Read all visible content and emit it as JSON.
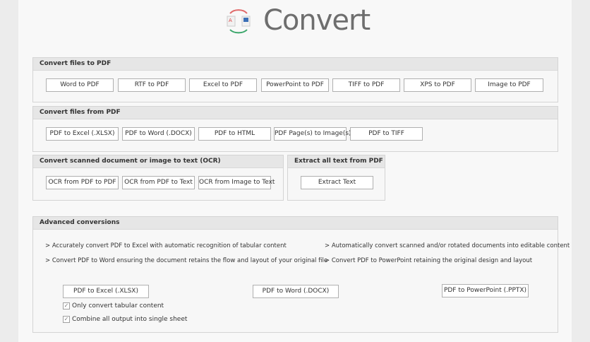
{
  "header": {
    "title": "Convert",
    "logo_icon": "pdf-word-convert-icon"
  },
  "to_pdf": {
    "title": "Convert files to PDF",
    "buttons": [
      "Word to PDF",
      "RTF to PDF",
      "Excel to PDF",
      "PowerPoint to PDF",
      "TIFF to PDF",
      "XPS to PDF",
      "Image to PDF"
    ]
  },
  "from_pdf": {
    "title": "Convert files from PDF",
    "buttons": [
      "PDF to Excel (.XLSX)",
      "PDF to Word (.DOCX)",
      "PDF to HTML",
      "PDF Page(s) to Image(s)",
      "PDF to TIFF"
    ]
  },
  "ocr": {
    "title": "Convert scanned document or image to text (OCR)",
    "buttons": [
      "OCR from PDF to PDF",
      "OCR from PDF to Text",
      "OCR from Image to Text"
    ]
  },
  "extract": {
    "title": "Extract all text from PDF",
    "button": "Extract Text"
  },
  "advanced": {
    "title": "Advanced conversions",
    "lines": [
      "> Accurately convert PDF to Excel with automatic recognition of tabular content",
      "> Automatically convert scanned and/or rotated documents into editable content",
      "> Convert PDF to Word ensuring the document retains the flow and layout of your original file",
      "> Convert PDF to PowerPoint retaining the original design and layout"
    ],
    "buttons": [
      "PDF to Excel (.XLSX)",
      "PDF to Word (.DOCX)",
      "PDF to PowerPoint (.PPTX)"
    ],
    "checkboxes": [
      {
        "label": "Only convert tabular content",
        "checked": true
      },
      {
        "label": "Combine all output into single sheet",
        "checked": true
      }
    ]
  }
}
